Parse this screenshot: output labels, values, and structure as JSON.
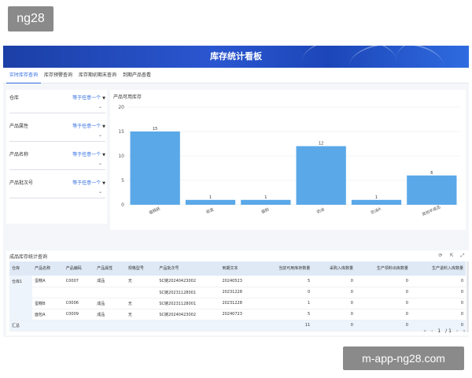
{
  "logo": "ng28",
  "watermark": "m-app-ng28.com",
  "banner": {
    "title": "库存统计看板"
  },
  "tabs": [
    {
      "label": "实时库存查询",
      "active": true
    },
    {
      "label": "库存预警查询",
      "active": false
    },
    {
      "label": "库存期初期末查询",
      "active": false
    },
    {
      "label": "到期产品查看",
      "active": false
    }
  ],
  "filters": [
    {
      "label": "仓库",
      "operator": "等于任意一个"
    },
    {
      "label": "产品属性",
      "operator": "等于任意一个"
    },
    {
      "label": "产品名称",
      "operator": "等于任意一个"
    },
    {
      "label": "产品批次号",
      "operator": "等于任意一个"
    }
  ],
  "chart_title": "产品可用库存",
  "chart_data": {
    "type": "bar",
    "title": "产品可用库存",
    "categories": [
      "蛋糕胚",
      "纸盒",
      "面粉",
      "奶油",
      "奶油A",
      "其他半成品"
    ],
    "values": [
      15,
      1,
      1,
      12,
      1,
      6
    ],
    "yticks": [
      0,
      5,
      10,
      15,
      20
    ],
    "ylim": [
      0,
      20
    ],
    "grid": true,
    "color": "#5aa8e8"
  },
  "table": {
    "title": "成品库存统计查询",
    "tools": [
      "⟳",
      "⇱",
      "⤢"
    ],
    "headers": [
      "仓库",
      "产品名称",
      "产品编码",
      "产品属性",
      "规格型号",
      "产品批次号",
      "到期文本",
      "当前可用库存数量",
      "采购入库数量",
      "生产领料出库数量",
      "生产退料入库数量"
    ],
    "rows": [
      [
        "仓库1",
        "蛋糕A",
        "C0007",
        "成品",
        "无",
        "SC链20240423002",
        "20240523",
        "5",
        "0",
        "0",
        "0"
      ],
      [
        "",
        "",
        "",
        "",
        "",
        "SC链20231128001",
        "20231228",
        "0",
        "0",
        "0",
        "0"
      ],
      [
        "",
        "蛋糕B",
        "C0006",
        "成品",
        "无",
        "SC链20231128001",
        "20231228",
        "1",
        "0",
        "0",
        "0"
      ],
      [
        "",
        "面包A",
        "C0009",
        "成品",
        "无",
        "SC链20240423002",
        "20240723",
        "5",
        "0",
        "0",
        "0"
      ]
    ],
    "total": {
      "label": "汇总",
      "values": [
        "11",
        "0",
        "0",
        "0"
      ]
    }
  },
  "pager": {
    "first": "«",
    "prev": "‹",
    "page": "1",
    "total": "/ 1",
    "next": "›",
    "last": "»"
  }
}
